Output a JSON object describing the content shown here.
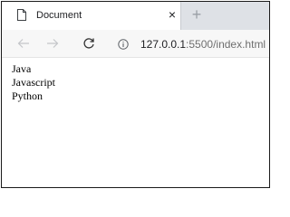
{
  "browser": {
    "tab": {
      "title": "Document",
      "icon": "document-icon",
      "close_label": "×"
    },
    "new_tab_label": "+",
    "nav": {
      "back_icon": "arrow-left-icon",
      "forward_icon": "arrow-right-icon",
      "reload_icon": "reload-icon"
    },
    "address_bar": {
      "info_icon": "info-icon",
      "url_host": "127.0.0.1",
      "url_rest": ":5500/index.html"
    }
  },
  "page": {
    "items": [
      "Java",
      "Javascript",
      "Python"
    ]
  }
}
